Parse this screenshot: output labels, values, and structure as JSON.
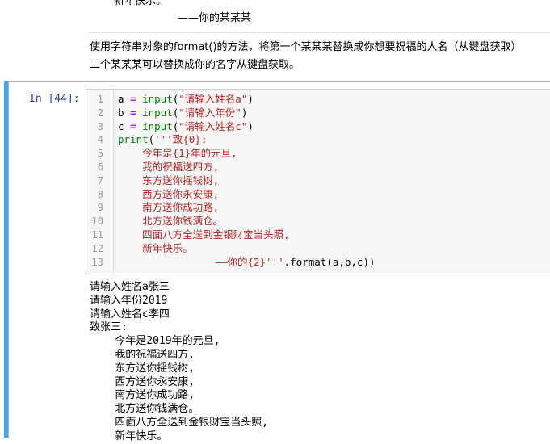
{
  "markdown": {
    "top_clipped_line": "新年快乐。",
    "signature": "——你的某某某",
    "instruction_line1": "使用字符串对象的format()的方法，将第一个某某某替换成你想要祝福的人名（从键盘获取）",
    "instruction_line2": "二个某某某可以替换成你的名字从键盘获取。"
  },
  "cell": {
    "prompt": "In  [44]:",
    "line_numbers": [
      "1",
      "2",
      "3",
      "4",
      "5",
      "6",
      "7",
      "8",
      "9",
      "10",
      "11",
      "12",
      "13"
    ],
    "code": {
      "l1": {
        "var": "a",
        "op": " = ",
        "fn": "input",
        "open": "(",
        "str": "\"请输入姓名a\"",
        "close": ")"
      },
      "l2": {
        "var": "b",
        "op": " = ",
        "fn": "input",
        "open": "(",
        "str": "\"请输入年份\"",
        "close": ")"
      },
      "l3": {
        "var": "c",
        "op": " = ",
        "fn": "input",
        "open": "(",
        "str": "\"请输入姓名c\"",
        "close": ")"
      },
      "l4": {
        "fn": "print",
        "open": "(",
        "str": "'''致{0}:"
      },
      "l5": "    今年是{1}年的元旦,",
      "l6": "    我的祝福送四方,",
      "l7": "    东方送你摇钱树,",
      "l8": "    西方送你永安康,",
      "l9": "    南方送你成功路,",
      "l10": "    北方送你钱满仓。",
      "l11": "    四面八方全送到金银财宝当头照,",
      "l12": "    新年快乐。",
      "l13": {
        "str": "                ——你的{2}'''",
        "rest": ".format(a,b,c))"
      }
    }
  },
  "output": {
    "lines": [
      "请输入姓名a张三",
      "请输入年份2019",
      "请输入姓名c李四",
      "致张三:",
      "    今年是2019年的元旦,",
      "    我的祝福送四方,",
      "    东方送你摇钱树,",
      "    西方送你永安康,",
      "    南方送你成功路,",
      "    北方送你钱满仓。",
      "    四面八方全送到金银财宝当头照,",
      "    新年快乐。"
    ]
  }
}
